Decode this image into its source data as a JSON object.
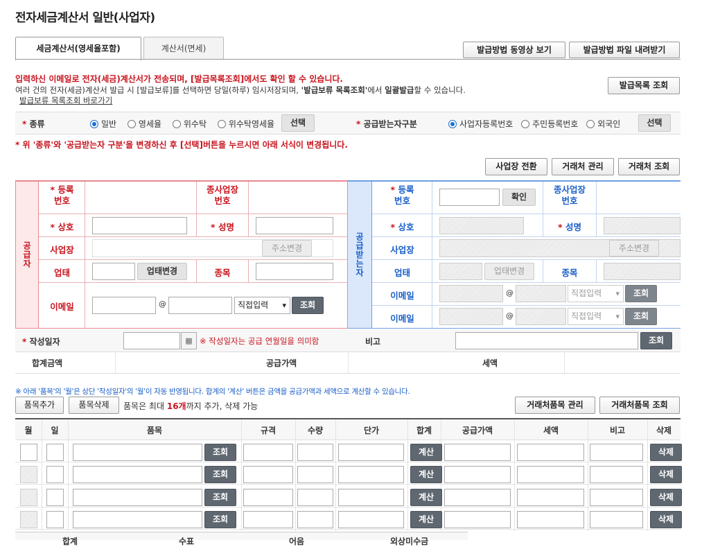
{
  "page_title": "전자세금계산서 일반(사업자)",
  "tabs": [
    {
      "label": "세금계산서(영세율포함)"
    },
    {
      "label": "계산서(면세)"
    }
  ],
  "top_buttons": {
    "video": "발급방법 동영상 보기",
    "download": "발급방법 파일 내려받기"
  },
  "notice": {
    "line1": "입력하신 이메일로 전자(세금)계산서가 전송되며, [발급목록조회]에서도 확인 할 수 있습니다.",
    "line2_a": "여러 건의 전자(세금)계산서 발급 시 [발급보류]를 선택하면 당일(하루) 임시저장되며, ",
    "line2_b": "'발급보류 목록조회'",
    "line2_c": "에서 ",
    "line2_d": "일괄발급",
    "line2_e": "할 수 있습니다.",
    "link": "발급보류 목록조회 바로가기",
    "list_button": "발급목록 조회"
  },
  "kind": {
    "label": "* 종류",
    "options": [
      "일반",
      "영세율",
      "위수탁",
      "위수탁영세율"
    ],
    "selected": 0,
    "select_button": "선택"
  },
  "receiver_type": {
    "label": "* 공급받는자구분",
    "options": [
      "사업자등록번호",
      "주민등록번호",
      "외국인"
    ],
    "selected": 0,
    "select_button": "선택"
  },
  "change_warning": "* 위 '종류'와 '공급받는자 구분'을 변경하신 후 [선택]버튼을 누르시면 아래 서식이 변경됩니다.",
  "action_buttons": {
    "switch": "사업장 전환",
    "manage": "거래처 관리",
    "lookup": "거래처 조회"
  },
  "supplier": {
    "side_label": "공급자",
    "reg_no": "* 등록\n번호",
    "branch_no": "종사업장\n번호",
    "name": "* 상호",
    "ceo": "* 성명",
    "address": "사업장",
    "address_button": "주소변경",
    "business_type": "업태",
    "business_type_button": "업태변경",
    "item": "종목",
    "email": "이메일",
    "email_domain": "직접입력",
    "lookup_button": "조회"
  },
  "receiver": {
    "side_label": "공급받는자",
    "reg_no": "* 등록\n번호",
    "confirm_button": "확인",
    "branch_no": "종사업장\n번호",
    "name": "* 상호",
    "ceo": "* 성명",
    "address": "사업장",
    "address_button": "주소변경",
    "business_type": "업태",
    "business_type_button": "업태변경",
    "item": "종목",
    "email1": "이메일",
    "email2": "이메일",
    "email_domain": "직접입력",
    "lookup_button": "조회"
  },
  "write_date": {
    "label": "* 작성일자",
    "hint": "※ 작성일자는 공급 연월일을 의미함",
    "remark_label": "비고",
    "remark_button": "조회"
  },
  "totals": {
    "total": "합계금액",
    "supply": "공급가액",
    "tax": "세액"
  },
  "items_notice": "※ 아래 '품목'의 '월'은 상단 '작성일자'의 '월'이 자동 반영됩니다. 합계의 '계산' 버튼은 금액을 공급가액과 세액으로 계산할 수 있습니다.",
  "item_buttons": {
    "add": "품목추가",
    "delete": "품목삭제",
    "manage": "거래처품목 관리",
    "lookup": "거래처품목 조회"
  },
  "item_limit": {
    "prefix": "품목은 최대 ",
    "count": "16개",
    "suffix": "까지 추가, 삭제 가능"
  },
  "item_table": {
    "headers": [
      "월",
      "일",
      "품목",
      "규격",
      "수량",
      "단가",
      "합계",
      "공급가액",
      "세액",
      "비고",
      "삭제"
    ],
    "row_lookup": "조회",
    "row_calc": "계산",
    "row_delete": "삭제",
    "rows": 4
  },
  "bottom_headers": [
    "합계",
    "수표",
    "어음",
    "외상미수금"
  ],
  "colors": {
    "red": "#c8141e",
    "supplier_side": "#fde9ea",
    "supplier_border": "#e8888e",
    "receiver_side": "#dbe8fb",
    "receiver_border": "#6f9fe0",
    "dark_button": "#5f6770"
  }
}
